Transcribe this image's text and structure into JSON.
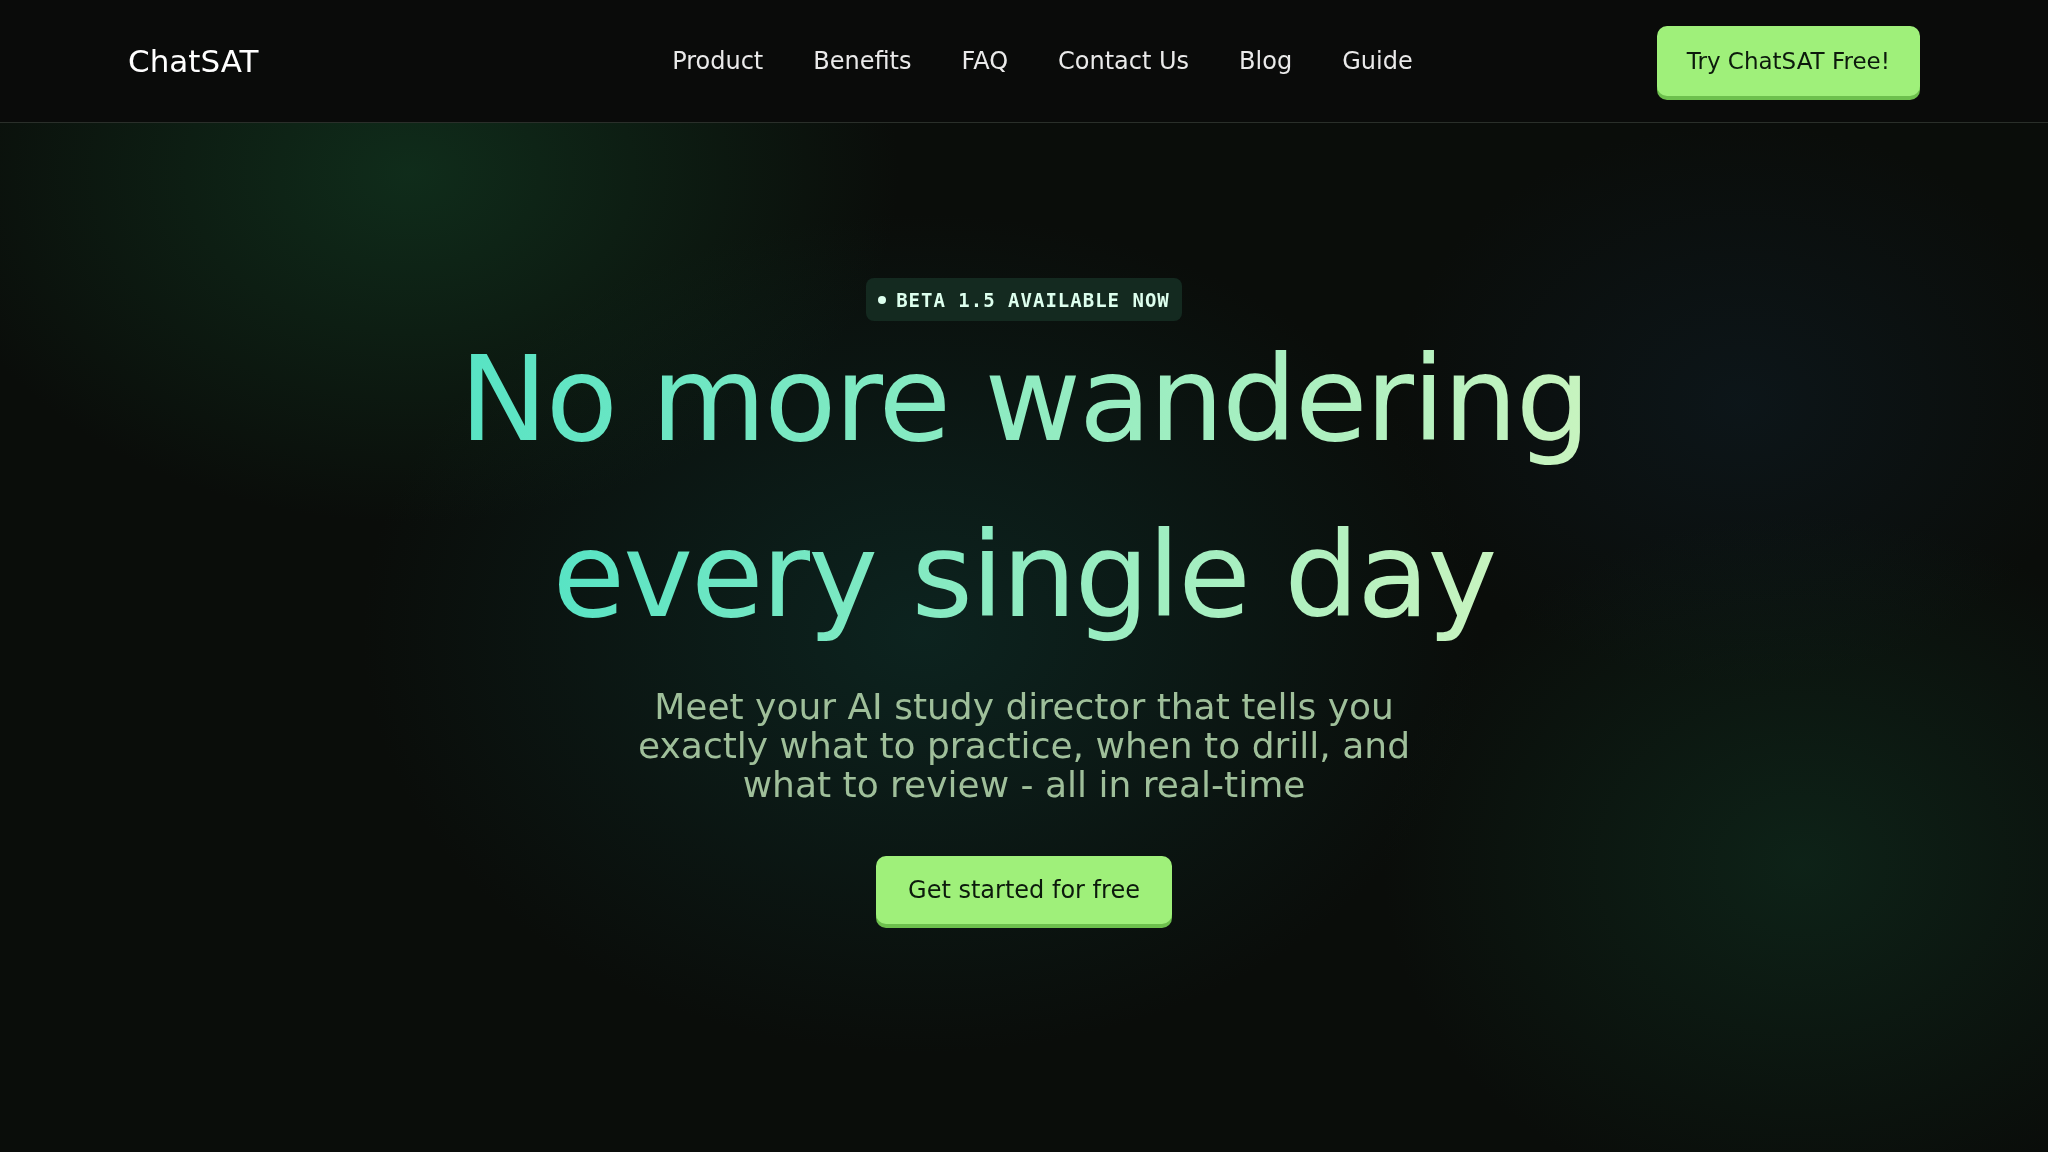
{
  "header": {
    "logo": "ChatSAT",
    "nav": [
      "Product",
      "Benefits",
      "FAQ",
      "Contact Us",
      "Blog",
      "Guide"
    ],
    "cta": "Try ChatSAT Free!"
  },
  "hero": {
    "badge": "BETA 1.5 AVAILABLE NOW",
    "headline": [
      "No more wandering",
      "every single day"
    ],
    "subtitle": "Meet your AI study director that tells you exactly what to practice, when to drill, and what to review - all in real-time",
    "cta": "Get started for free"
  }
}
